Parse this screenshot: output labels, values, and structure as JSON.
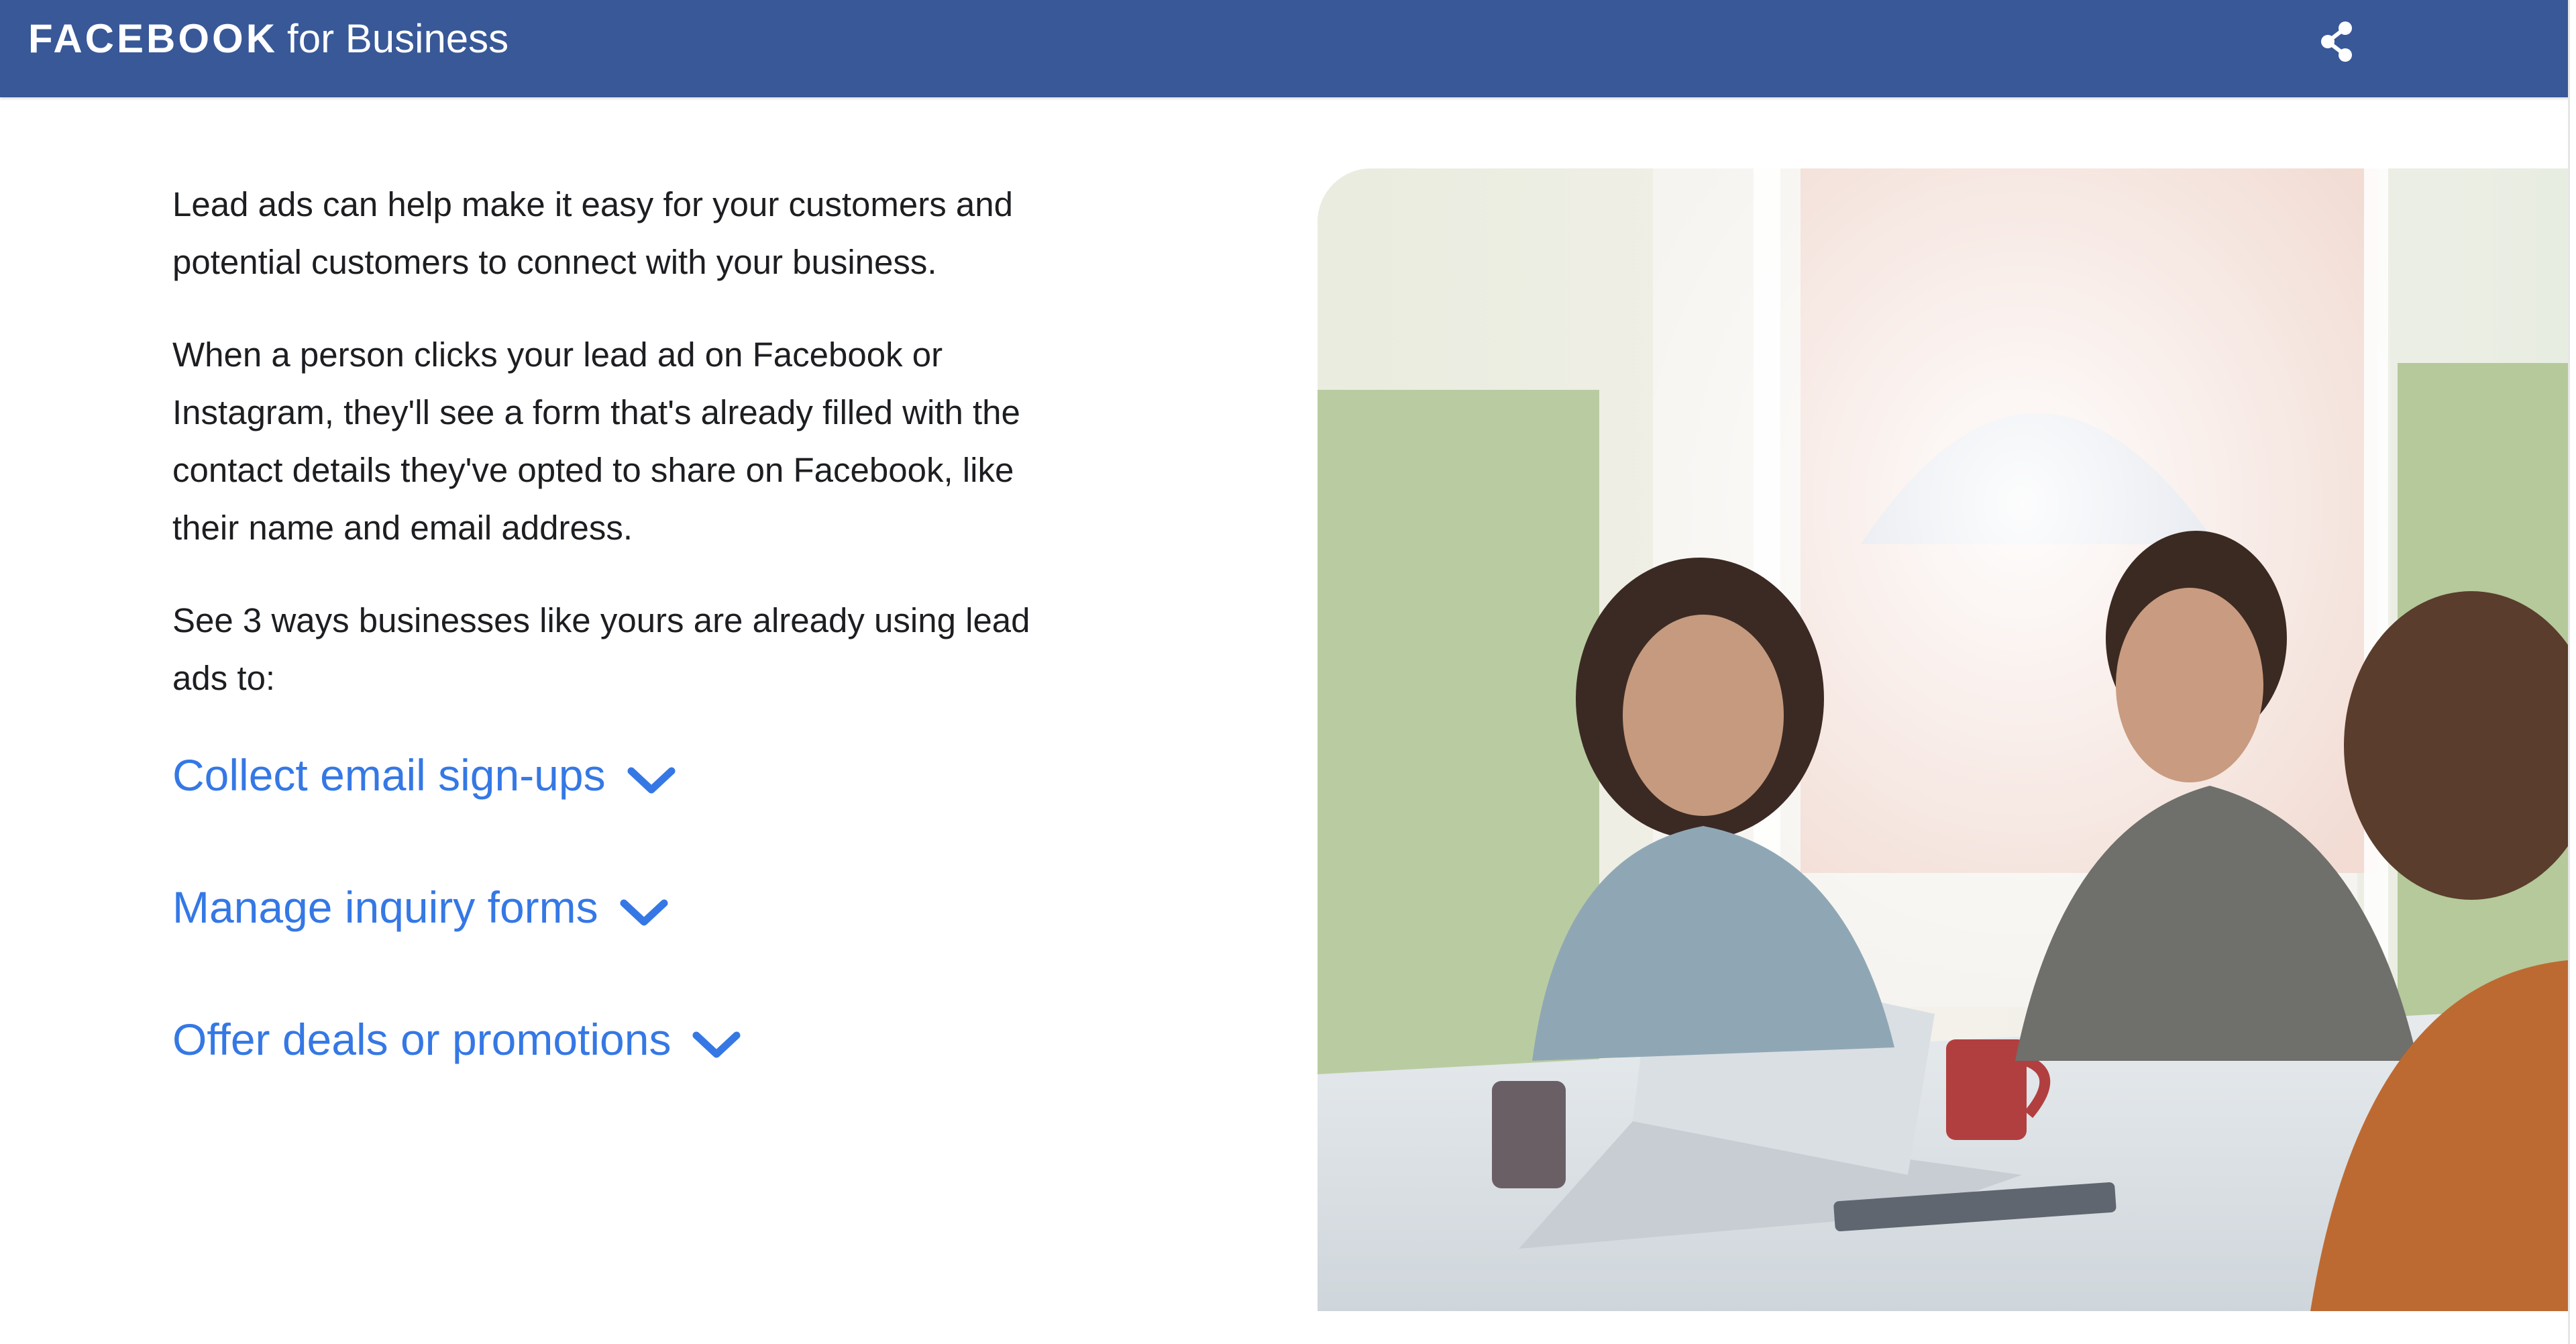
{
  "header": {
    "brand_primary": "FACEBOOK",
    "brand_secondary": "for Business",
    "share_icon": "share-icon",
    "background_color": "#385898"
  },
  "main": {
    "paragraphs": [
      "Lead ads can help make it easy for your customers and potential customers to connect with your business.",
      "When a person clicks your lead ad on Facebook or Instagram, they'll see a form that's already filled with the contact details they've opted to share on Facebook, like their name and email address.",
      "See 3 ways businesses like yours are already using lead ads to:"
    ],
    "accordion": [
      {
        "label": "Collect email sign-ups",
        "icon": "chevron-down-icon"
      },
      {
        "label": "Manage inquiry forms",
        "icon": "chevron-down-icon"
      },
      {
        "label": "Offer deals or promotions",
        "icon": "chevron-down-icon"
      }
    ],
    "link_color": "#3578e5"
  },
  "hero_image": {
    "subject": "photo of three people at a table with a laptop and mugs"
  }
}
